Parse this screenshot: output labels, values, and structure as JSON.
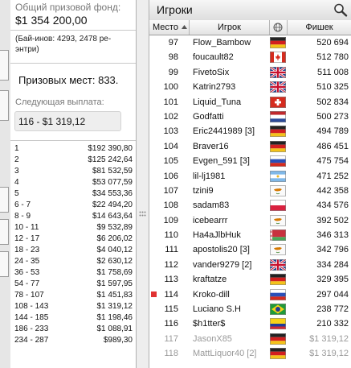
{
  "prize_panel": {
    "total_label": "Общий призовой фонд:",
    "total_value": "$1 354 200,00",
    "entries_text": "(Бай-инов: 4293, 2478 ре-энтри)",
    "places_text": "Призовых мест: 833.",
    "next_label": "Следующая выплата:",
    "next_value": "116 - $1 319,12",
    "payouts": [
      {
        "place": "1",
        "amount": "$192 390,80"
      },
      {
        "place": "2",
        "amount": "$125 242,64"
      },
      {
        "place": "3",
        "amount": "$81 532,59"
      },
      {
        "place": "4",
        "amount": "$53 077,59"
      },
      {
        "place": "5",
        "amount": "$34 553,36"
      },
      {
        "place": "6 - 7",
        "amount": "$22 494,20"
      },
      {
        "place": "8 - 9",
        "amount": "$14 643,64"
      },
      {
        "place": "10 - 11",
        "amount": "$9 532,89"
      },
      {
        "place": "12 - 17",
        "amount": "$6 206,02"
      },
      {
        "place": "18 - 23",
        "amount": "$4 040,12"
      },
      {
        "place": "24 - 35",
        "amount": "$2 630,12"
      },
      {
        "place": "36 - 53",
        "amount": "$1 758,69"
      },
      {
        "place": "54 - 77",
        "amount": "$1 597,95"
      },
      {
        "place": "78 - 107",
        "amount": "$1 451,83"
      },
      {
        "place": "108 - 143",
        "amount": "$1 319,12"
      },
      {
        "place": "144 - 185",
        "amount": "$1 198,46"
      },
      {
        "place": "186 - 233",
        "amount": "$1 088,91"
      },
      {
        "place": "234 - 287",
        "amount": "$989,30"
      }
    ]
  },
  "players_panel": {
    "title": "Игроки",
    "columns": {
      "rank": "Место",
      "player": "Игрок",
      "chips": "Фишек"
    },
    "rows": [
      {
        "rank": "97",
        "name": "Flow_Bambow",
        "flag": "germany-flag",
        "chips": "520 694"
      },
      {
        "rank": "98",
        "name": "foucault82",
        "flag": "canada-flag",
        "chips": "512 780"
      },
      {
        "rank": "99",
        "name": "FivetoSix",
        "flag": "uk-flag",
        "chips": "511 008"
      },
      {
        "rank": "100",
        "name": "Katrin2793",
        "flag": "uk-flag",
        "chips": "510 325"
      },
      {
        "rank": "101",
        "name": "Liquid_Tuna",
        "flag": "switzerland-flag",
        "chips": "502 834"
      },
      {
        "rank": "102",
        "name": "Godfatti",
        "flag": "netherlands-flag",
        "chips": "500 273"
      },
      {
        "rank": "103",
        "name": "Eric2441989 [3]",
        "flag": "germany-flag",
        "chips": "494 789"
      },
      {
        "rank": "104",
        "name": "Braver16",
        "flag": "germany-flag",
        "chips": "486 451"
      },
      {
        "rank": "105",
        "name": "Evgen_591 [3]",
        "flag": "russia-flag",
        "chips": "475 754"
      },
      {
        "rank": "106",
        "name": "lil-lj1981",
        "flag": "argentina-flag",
        "chips": "471 252"
      },
      {
        "rank": "107",
        "name": "tzini9",
        "flag": "cyprus-flag",
        "chips": "442 358"
      },
      {
        "rank": "108",
        "name": "sadam83",
        "flag": "poland-flag",
        "chips": "434 576"
      },
      {
        "rank": "109",
        "name": "icebearrr",
        "flag": "cyprus-flag",
        "chips": "392 502"
      },
      {
        "rank": "110",
        "name": "Ha4aJlbHuk",
        "flag": "belarus-flag",
        "chips": "346 313"
      },
      {
        "rank": "111",
        "name": "apostolis20 [3]",
        "flag": "cyprus-flag",
        "chips": "342 796"
      },
      {
        "rank": "112",
        "name": "vander9279 [2]",
        "flag": "uk-flag",
        "chips": "334 284"
      },
      {
        "rank": "113",
        "name": "kraftatze",
        "flag": "germany-flag",
        "chips": "329 395"
      },
      {
        "rank": "114",
        "name": "Kroko-dill",
        "flag": "russia-flag",
        "chips": "297 044",
        "highlight": true
      },
      {
        "rank": "115",
        "name": "Luciano S.H",
        "flag": "brazil-flag",
        "chips": "238 772"
      },
      {
        "rank": "116",
        "name": "$h1tter$",
        "flag": "colombia-flag",
        "chips": "210 332"
      },
      {
        "rank": "117",
        "name": "JasonX85",
        "flag": "germany-flag",
        "chips": "$1 319,12",
        "eliminated": true
      },
      {
        "rank": "118",
        "name": "MattLiquor40 [2]",
        "flag": "germany-flag",
        "chips": "$1 319,12",
        "eliminated": true
      }
    ]
  },
  "colors": {
    "accent_red": "#e03131",
    "eliminated_gray": "#9a9a9a"
  }
}
